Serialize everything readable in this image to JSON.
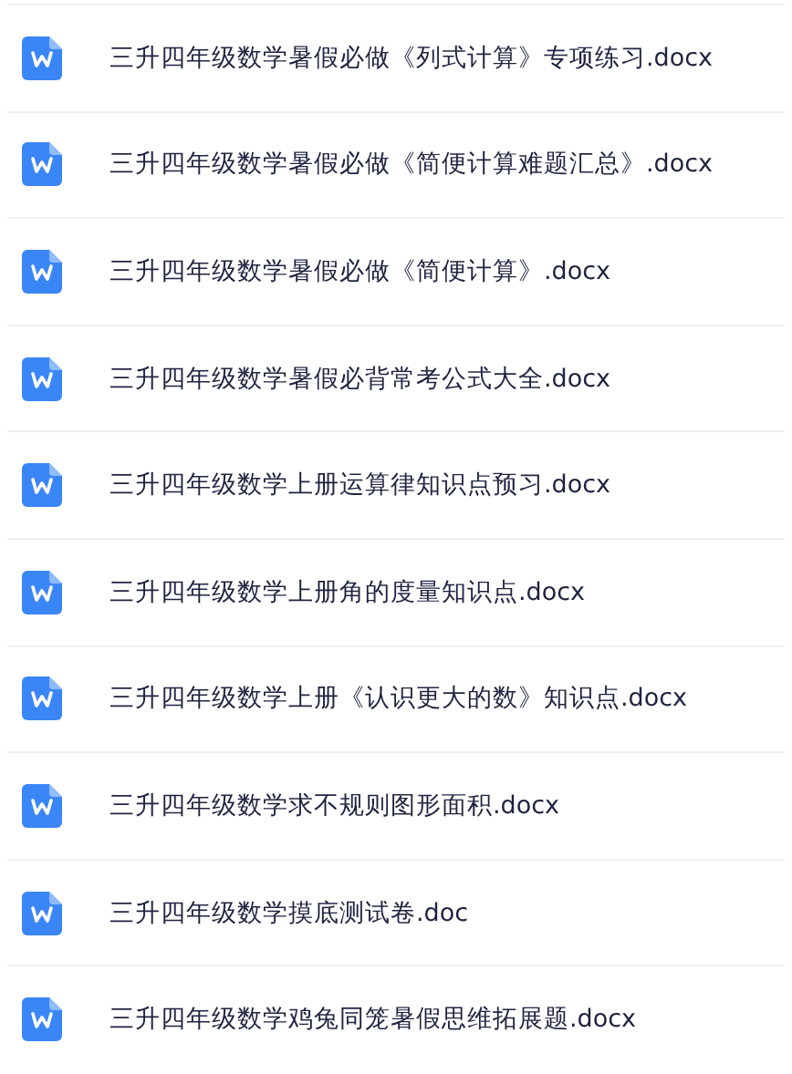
{
  "files": [
    {
      "name": "三升四年级数学暑假必做《列式计算》专项练习.docx"
    },
    {
      "name": "三升四年级数学暑假必做《简便计算难题汇总》.docx"
    },
    {
      "name": "三升四年级数学暑假必做《简便计算》.docx"
    },
    {
      "name": "三升四年级数学暑假必背常考公式大全.docx"
    },
    {
      "name": "三升四年级数学上册运算律知识点预习.docx"
    },
    {
      "name": "三升四年级数学上册角的度量知识点.docx"
    },
    {
      "name": "三升四年级数学上册《认识更大的数》知识点.docx"
    },
    {
      "name": "三升四年级数学求不规则图形面积.docx"
    },
    {
      "name": "三升四年级数学摸底测试卷.doc"
    },
    {
      "name": "三升四年级数学鸡兔同笼暑假思维拓展题.docx"
    }
  ]
}
